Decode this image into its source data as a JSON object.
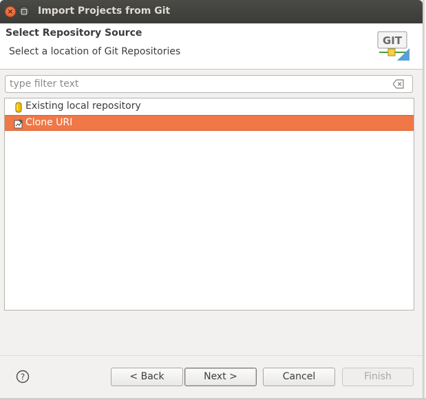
{
  "window": {
    "title": "Import Projects from Git"
  },
  "header": {
    "title": "Select Repository Source",
    "description": "Select a location of Git Repositories",
    "logo_text": "GIT"
  },
  "filter": {
    "placeholder": "type filter text",
    "value": ""
  },
  "sources": [
    {
      "label": "Existing local repository",
      "icon": "repository-icon",
      "selected": false
    },
    {
      "label": "Clone URI",
      "icon": "clone-uri-icon",
      "selected": true
    }
  ],
  "buttons": {
    "back": "< Back",
    "next": "Next >",
    "cancel": "Cancel",
    "finish": "Finish"
  },
  "colors": {
    "selection": "#f07746",
    "titlebar": "#3b3b38",
    "close_button": "#e0541f"
  }
}
